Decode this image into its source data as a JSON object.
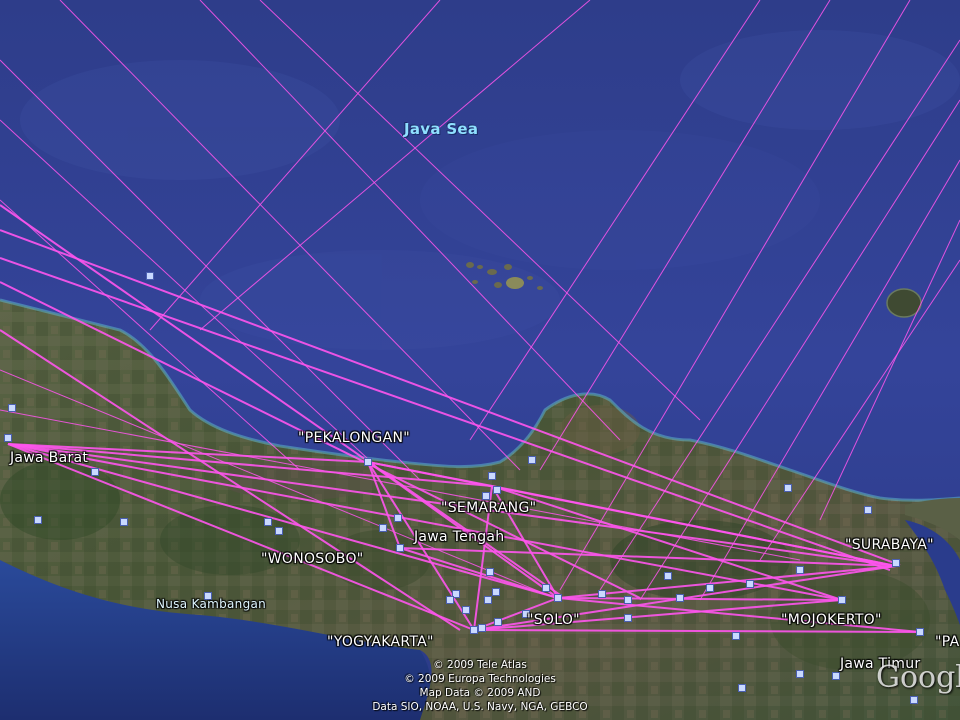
{
  "map": {
    "sea_label": "Java Sea",
    "place_labels": [
      {
        "name": "pekalongan",
        "text": "\"PEKALONGAN\""
      },
      {
        "name": "semarang",
        "text": "\"SEMARANG\""
      },
      {
        "name": "wonosobo",
        "text": "\"WONOSOBO\""
      },
      {
        "name": "yogyakarta",
        "text": "\"YOGYAKARTA\""
      },
      {
        "name": "solo",
        "text": "\"SOLO\""
      },
      {
        "name": "surabaya",
        "text": "\"SURABAYA\""
      },
      {
        "name": "mojokerto",
        "text": "\"MOJOKERTO\""
      },
      {
        "name": "pa-partial",
        "text": "\"PA"
      }
    ],
    "region_labels": {
      "jawa_barat": "Jawa Barat",
      "jawa_tengah": "Jawa Tengah",
      "jawa_timur": "Jawa Timur",
      "nusa_kambangan": "Nusa Kambangan"
    },
    "attribution": {
      "line1": "© 2009 Tele Atlas",
      "line2": "© 2009 Europa Technologies",
      "line3": "Map Data © 2009 AND",
      "line4": "Data SIO, NOAA, U.S. Navy, NGA, GEBCO"
    },
    "logo_text": "Google",
    "colors": {
      "sea": "#2f3f8c",
      "deep_sea": "#26367f",
      "land": "#4b5a3a",
      "route_line": "#ff55ee",
      "marker": "#c9d9ff"
    },
    "icons": {
      "place_marker": "square-marker-icon"
    }
  }
}
